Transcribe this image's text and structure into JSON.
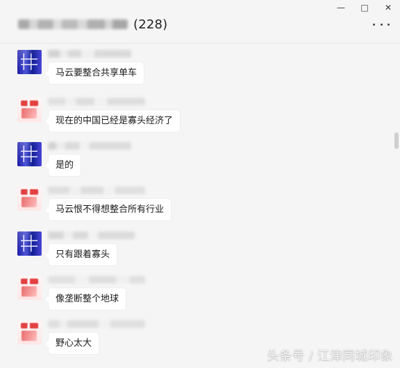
{
  "window": {
    "title_count": "(228)",
    "controls": [
      "—",
      "□",
      "✕"
    ]
  },
  "messages": [
    {
      "avatar": "blue",
      "text": "马云要整合共享单车"
    },
    {
      "avatar": "red",
      "text": "现在的中国已经是寡头经济了"
    },
    {
      "avatar": "blue",
      "text": "是的"
    },
    {
      "avatar": "red",
      "text": "马云恨不得想整合所有行业"
    },
    {
      "avatar": "blue",
      "text": "只有跟着寡头"
    },
    {
      "avatar": "red",
      "text": "像垄断整个地球"
    },
    {
      "avatar": "red",
      "text": "野心太大"
    }
  ],
  "watermark": "头条号 / 江津同城印象",
  "icons": {
    "minimize": "minimize-icon",
    "maximize": "maximize-icon",
    "close": "close-icon",
    "more": "more-icon"
  }
}
